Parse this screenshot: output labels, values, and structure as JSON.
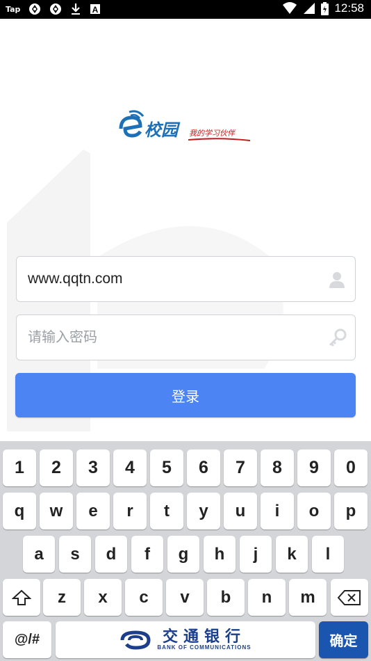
{
  "status_bar": {
    "left_label": "Tap",
    "time": "12:58"
  },
  "logo": {
    "name": "校园",
    "slogan": "我的学习伙伴"
  },
  "login": {
    "username_value": "www.qqtn.com",
    "password_placeholder": "请输入密码",
    "submit_label": "登录"
  },
  "keyboard": {
    "row_numbers": [
      "1",
      "2",
      "3",
      "4",
      "5",
      "6",
      "7",
      "8",
      "9",
      "0"
    ],
    "row_1": [
      "q",
      "w",
      "e",
      "r",
      "t",
      "y",
      "u",
      "i",
      "o",
      "p"
    ],
    "row_2": [
      "a",
      "s",
      "d",
      "f",
      "g",
      "h",
      "j",
      "k",
      "l"
    ],
    "row_3": [
      "z",
      "x",
      "c",
      "v",
      "b",
      "n",
      "m"
    ],
    "symbol_label": "@/#",
    "space_bank_cn": "交通银行",
    "space_bank_en": "BANK OF COMMUNICATIONS",
    "confirm_label": "确定"
  },
  "colors": {
    "primary_button": "#4c84f3",
    "confirm_key": "#1a56b0",
    "logo_blue": "#1d6fb6",
    "slogan_red": "#c41a1a"
  }
}
